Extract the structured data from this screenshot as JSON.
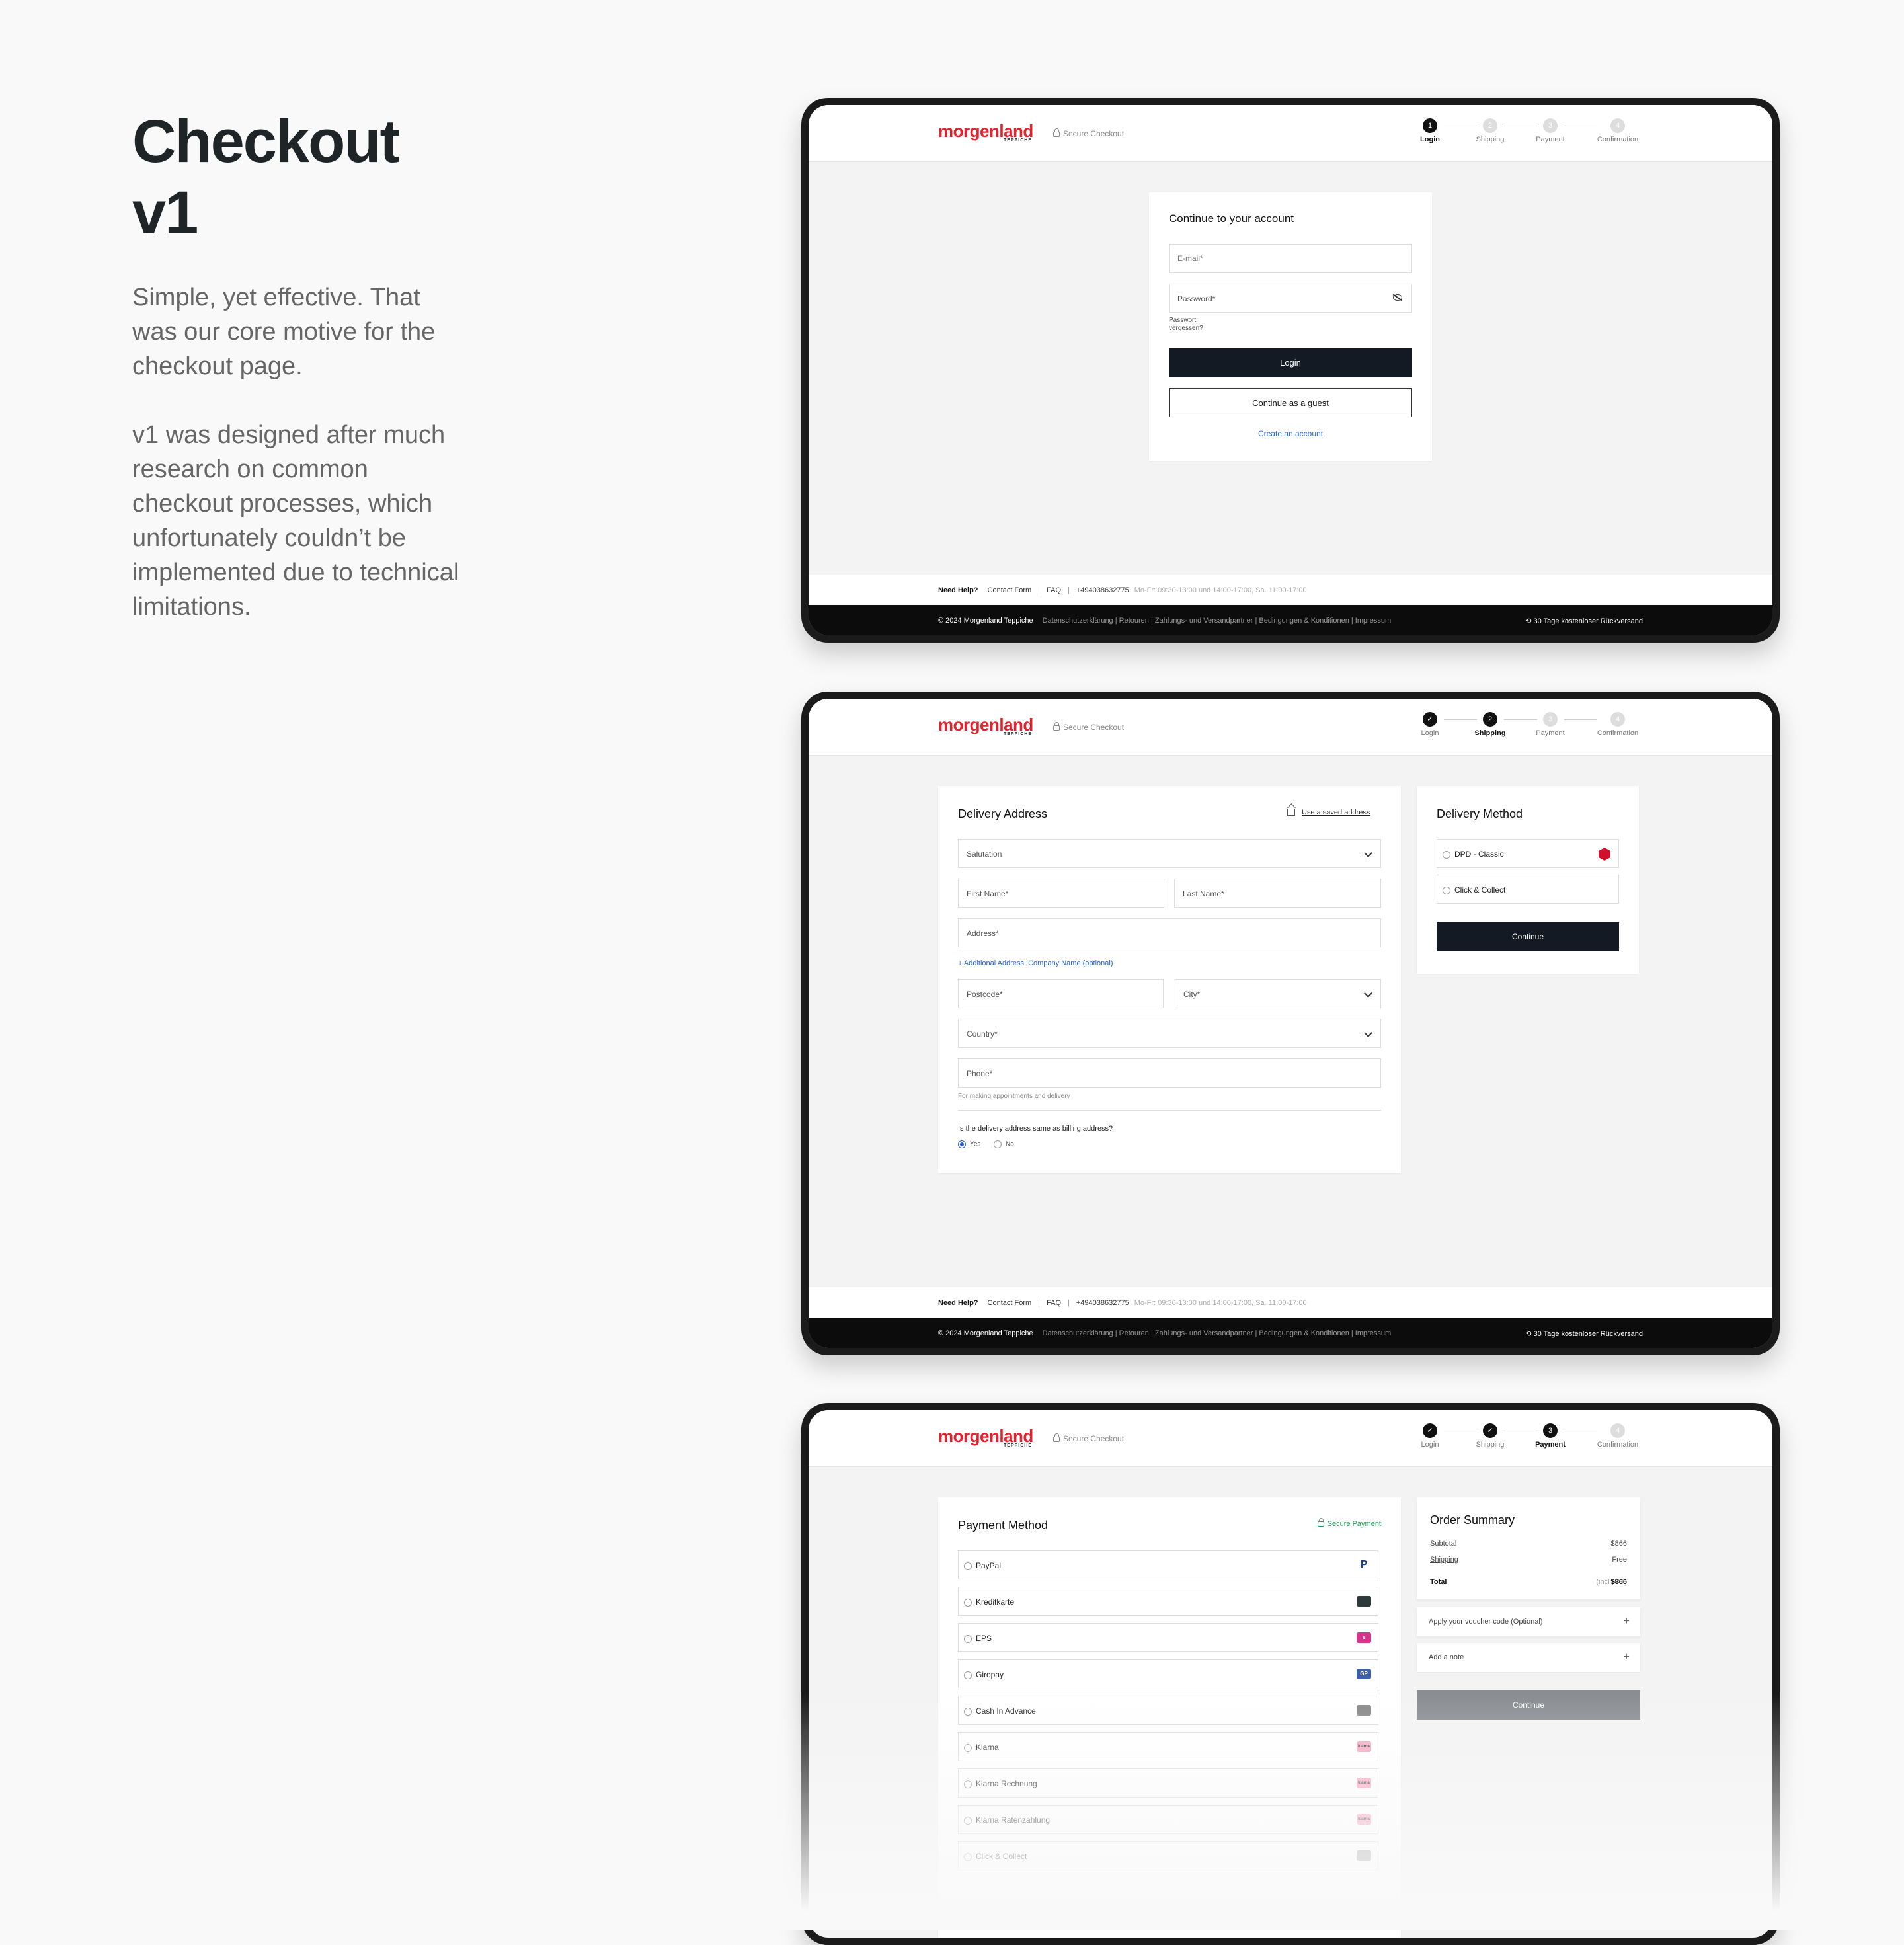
{
  "intro": {
    "title": "Checkout v1",
    "para1": "Simple, yet effective. That was our core motive for the checkout page.",
    "para2": "v1 was designed after much research on common checkout processes, which unfortunately couldn’t be implemented due to technical limitations."
  },
  "brand": {
    "logo": "morgenland",
    "logo_sub": "TEPPICHE",
    "secure_checkout": "Secure Checkout",
    "accent": "#e4222d"
  },
  "steps": {
    "labels": [
      "Login",
      "Shipping",
      "Payment",
      "Confirmation"
    ],
    "numbers": [
      "1",
      "2",
      "3",
      "4"
    ],
    "check": "✓"
  },
  "footer": {
    "need_help": "Need Help?",
    "contact": "Contact Form",
    "faq": "FAQ",
    "phone": "+494038632775",
    "hours": "Mo-Fr: 09:30-13:00 und 14:00-17:00, Sa. 11:00-17:00",
    "copyright": "© 2024 Morgenland Teppiche",
    "links": "Datenschutzerklärung | Retouren | Zahlungs- und Versandpartner | Bedingungen & Konditionen | Impressum",
    "returns": "30 Tage kostenloser Rückversand",
    "separator": "|"
  },
  "login": {
    "title": "Continue to your account",
    "email_placeholder": "E-mail*",
    "password_placeholder": "Password*",
    "forgot": "Passwort vergessen?",
    "login_btn": "Login",
    "guest_btn": "Continue as a guest",
    "create": "Create an account"
  },
  "shipping": {
    "title": "Delivery Address",
    "saved": "Use a saved address",
    "salutation": "Salutation",
    "first": "First Name*",
    "last": "Last Name*",
    "address": "Address*",
    "additional": "+ Additional Address, Company Name (optional)",
    "postcode": "Postcode*",
    "city": "City*",
    "country": "Country*",
    "phone": "Phone*",
    "phone_hint": "For making appointments and delivery",
    "billing_q": "Is the delivery address same as billing address?",
    "yes": "Yes",
    "no": "No",
    "method_title": "Delivery Method",
    "dpd": "DPD - Classic",
    "click": "Click & Collect",
    "continue": "Continue"
  },
  "payment": {
    "title": "Payment Method",
    "secure": "Secure Payment",
    "methods": [
      "PayPal",
      "Kreditkarte",
      "EPS",
      "Giropay",
      "Cash In Advance",
      "Klarna",
      "Klarna Rechnung",
      "Klarna Ratenzahlung",
      "Click & Collect"
    ],
    "icons": [
      "P",
      "",
      "e",
      "GP",
      "",
      "klarna",
      "klarna",
      "klarna",
      ""
    ],
    "summary_title": "Order Summary",
    "subtotal_label": "Subtotal",
    "subtotal": "$866",
    "shipping_label": "Shipping",
    "shipping": "Free",
    "total_label": "Total",
    "total_note": "(incl VAT)",
    "total": "$866",
    "voucher": "Apply your voucher code (Optional)",
    "note": "Add a note",
    "plus": "+",
    "continue": "Continue"
  }
}
